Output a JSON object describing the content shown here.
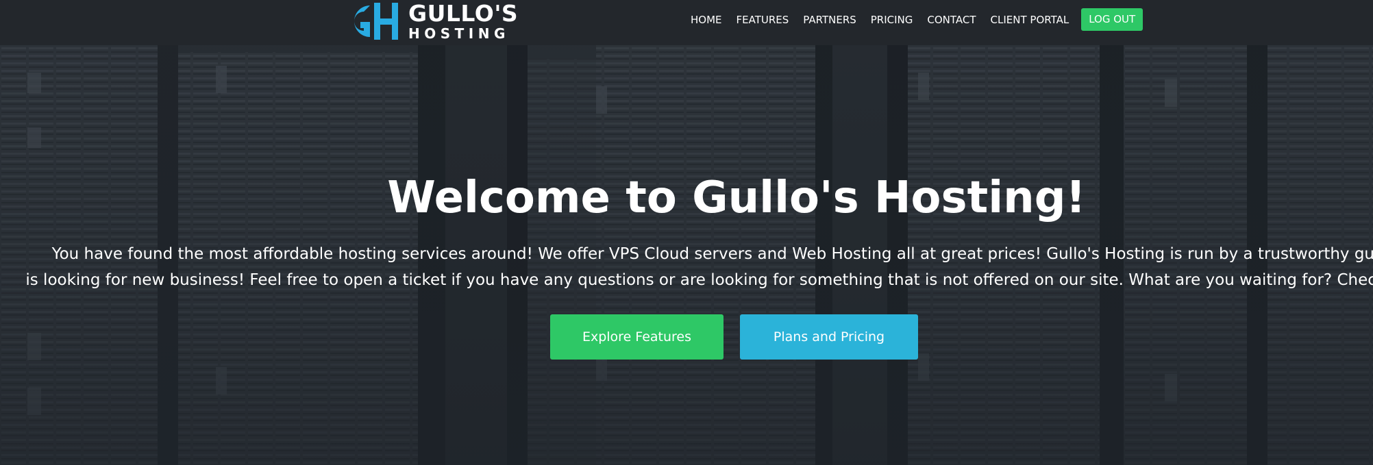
{
  "brand": {
    "line1": "GULLO'S",
    "line2": "HOSTING",
    "mark_letters": "GH",
    "mark_color": "#29abe2"
  },
  "nav": {
    "items": [
      {
        "label": "HOME"
      },
      {
        "label": "FEATURES"
      },
      {
        "label": "PARTNERS"
      },
      {
        "label": "PRICING"
      },
      {
        "label": "CONTACT"
      },
      {
        "label": "CLIENT PORTAL"
      }
    ],
    "logout_label": "LOG OUT"
  },
  "hero": {
    "title": "Welcome to Gullo's Hosting!",
    "text_line1": "You have found the most affordable hosting services around! We offer VPS Cloud servers and Web Hosting all at great prices! Gullo's Hosting is run by a trustworthy guy who",
    "text_line2": "is looking for new business! Feel free to open a ticket if you have any questions or are looking for something that is not offered on our site. What are you waiting for? Check out our",
    "buttons": {
      "features": "Explore Features",
      "pricing": "Plans and Pricing"
    }
  },
  "colors": {
    "navbar": "#23272c",
    "accent_green": "#2ec866",
    "accent_blue": "#2bb3d9"
  },
  "icons": [
    "gh-logo-icon",
    "server-rack-background"
  ]
}
